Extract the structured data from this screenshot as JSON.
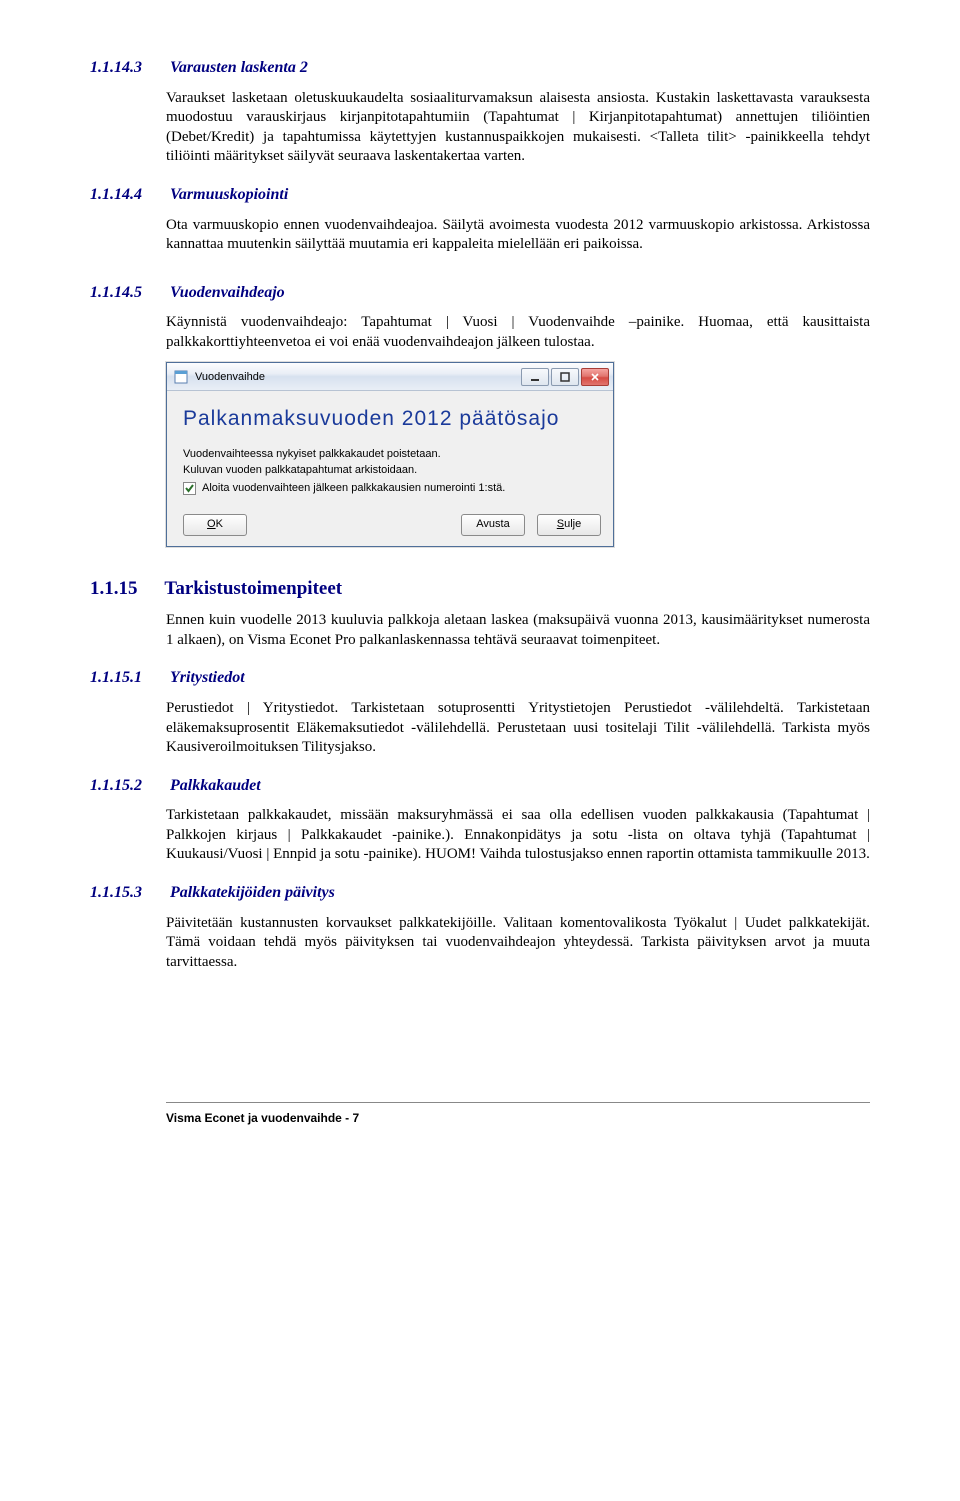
{
  "s1": {
    "num": "1.1.14.3",
    "title": "Varausten laskenta 2",
    "p1": "Varaukset lasketaan oletuskuukaudelta sosiaaliturvamaksun alaisesta ansiosta. Kustakin laskettavasta varauksesta muodostuu varauskirjaus kirjanpitotapahtumiin (Tapahtumat | Kirjanpitotapahtumat) annettujen tiliöintien (Debet/Kredit) ja tapahtumissa käytettyjen kustannuspaikkojen mukaisesti. <Talleta tilit> -painikkeella tehdyt tiliöinti määritykset säilyvät seuraava laskentakertaa varten."
  },
  "s2": {
    "num": "1.1.14.4",
    "title": "Varmuuskopiointi",
    "p1": "Ota varmuuskopio ennen vuodenvaihdeajoa. Säilytä avoimesta vuodesta 2012 varmuuskopio arkistossa. Arkistossa kannattaa muutenkin säilyttää muutamia eri kappaleita mielellään eri paikoissa."
  },
  "s3": {
    "num": "1.1.14.5",
    "title": "Vuodenvaihdeajo",
    "p1": "Käynnistä vuodenvaihdeajo: Tapahtumat | Vuosi | Vuodenvaihde –painike. Huomaa, että kausittaista palkkakorttiyhteenvetoa ei voi enää vuodenvaihdeajon jälkeen tulostaa."
  },
  "dialog": {
    "window_title": "Vuodenvaihde",
    "big_title": "Palkanmaksuvuoden  2012  päätösajo",
    "line1": "Vuodenvaihteessa nykyiset palkkakaudet poistetaan.",
    "line2": "Kuluvan vuoden palkkatapahtumat arkistoidaan.",
    "check_label": "Aloita vuodenvaihteen jälkeen palkkakausien numerointi 1:stä.",
    "ok": "OK",
    "avusta": "Avusta",
    "sulje": "Sulje"
  },
  "s4": {
    "num": "1.1.15",
    "title": "Tarkistustoimenpiteet",
    "p1": "Ennen kuin vuodelle 2013 kuuluvia palkkoja aletaan laskea (maksupäivä vuonna 2013, kausimääritykset numerosta 1 alkaen), on Visma Econet Pro palkanlaskennassa tehtävä seuraavat toimenpiteet."
  },
  "s5": {
    "num": "1.1.15.1",
    "title": "Yritystiedot",
    "p1": "Perustiedot | Yritystiedot. Tarkistetaan sotuprosentti Yritystietojen Perustiedot -välilehdeltä. Tarkistetaan eläkemaksuprosentit Eläkemaksutiedot -välilehdellä. Perustetaan uusi tositelaji Tilit -välilehdellä. Tarkista myös Kausiveroilmoituksen Tilitysjakso."
  },
  "s6": {
    "num": "1.1.15.2",
    "title": "Palkkakaudet",
    "p1": "Tarkistetaan palkkakaudet, missään maksuryhmässä ei saa olla edellisen vuoden palkkakausia (Tapahtumat | Palkkojen kirjaus | Palkkakaudet -painike.). Ennakonpidätys ja sotu -lista on oltava tyhjä (Tapahtumat | Kuukausi/Vuosi | Ennpid ja sotu -painike). HUOM! Vaihda tulostusjakso ennen raportin ottamista tammikuulle 2013."
  },
  "s7": {
    "num": "1.1.15.3",
    "title": "Palkkatekijöiden päivitys",
    "p1": "Päivitetään kustannusten korvaukset palkkatekijöille. Valitaan komentovalikosta Työkalut | Uudet palkkatekijät. Tämä voidaan tehdä myös päivityksen tai vuodenvaihdeajon yhteydessä. Tarkista päivityksen arvot ja muuta tarvittaessa."
  },
  "footer": {
    "text": "Visma Econet ja vuodenvaihde - 7"
  }
}
